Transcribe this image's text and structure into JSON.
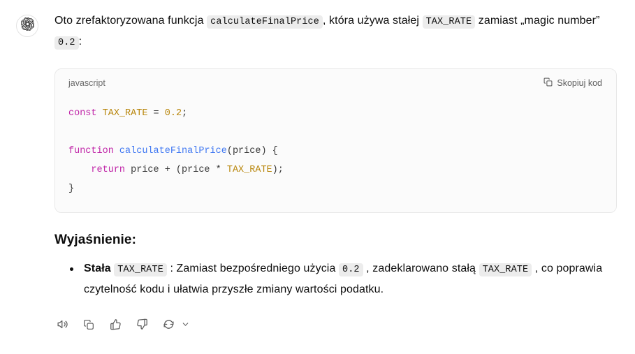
{
  "message": {
    "avatar_icon": "chatgpt-logo-icon",
    "paragraph": {
      "part1": "Oto zrefaktoryzowana funkcja ",
      "code1": "calculateFinalPrice",
      "part2": ", która używa stałej ",
      "code2": "TAX_RATE",
      "part3": " zamiast „magic number” ",
      "code3": "0.2",
      "part4": ":"
    }
  },
  "codeblock": {
    "language": "javascript",
    "copy_label": "Skopiuj kod",
    "copy_icon": "copy-icon",
    "lines": [
      {
        "tokens": [
          {
            "text": "const",
            "type": "kw"
          },
          {
            "text": " ",
            "type": "plain"
          },
          {
            "text": "TAX_RATE",
            "type": "const"
          },
          {
            "text": " = ",
            "type": "plain"
          },
          {
            "text": "0.2",
            "type": "const"
          },
          {
            "text": ";",
            "type": "plain"
          }
        ]
      },
      {
        "tokens": []
      },
      {
        "tokens": [
          {
            "text": "function",
            "type": "kw"
          },
          {
            "text": " ",
            "type": "plain"
          },
          {
            "text": "calculateFinalPrice",
            "type": "fn"
          },
          {
            "text": "(price) {",
            "type": "plain"
          }
        ]
      },
      {
        "tokens": [
          {
            "text": "    ",
            "type": "plain"
          },
          {
            "text": "return",
            "type": "kw"
          },
          {
            "text": " price + (price * ",
            "type": "plain"
          },
          {
            "text": "TAX_RATE",
            "type": "const"
          },
          {
            "text": ");",
            "type": "plain"
          }
        ]
      },
      {
        "tokens": [
          {
            "text": "}",
            "type": "plain"
          }
        ]
      }
    ],
    "colors": {
      "keyword": "#c026a8",
      "constant": "#b8860b",
      "function": "#4078f2",
      "plain": "#383838",
      "background": "#fbfbfb",
      "border": "#e8e8e8"
    }
  },
  "explanation": {
    "title": "Wyjaśnienie:",
    "bullets": [
      {
        "bold": "Stała",
        "code1": "TAX_RATE",
        "mid1": " : Zamiast bezpośredniego użycia ",
        "code2": "0.2",
        "mid2": " , zadeklarowano stałą ",
        "code3": "TAX_RATE",
        "tail": " , co poprawia czytelność kodu i ułatwia przyszłe zmiany wartości podatku."
      }
    ]
  },
  "actions": [
    {
      "name": "read-aloud-button",
      "icon": "speaker-icon"
    },
    {
      "name": "copy-button",
      "icon": "copy-icon"
    },
    {
      "name": "thumbs-up-button",
      "icon": "thumbs-up-icon"
    },
    {
      "name": "thumbs-down-button",
      "icon": "thumbs-down-icon"
    },
    {
      "name": "regenerate-button",
      "icon": "refresh-icon"
    },
    {
      "name": "regenerate-dropdown",
      "icon": "chevron-down-icon"
    }
  ]
}
